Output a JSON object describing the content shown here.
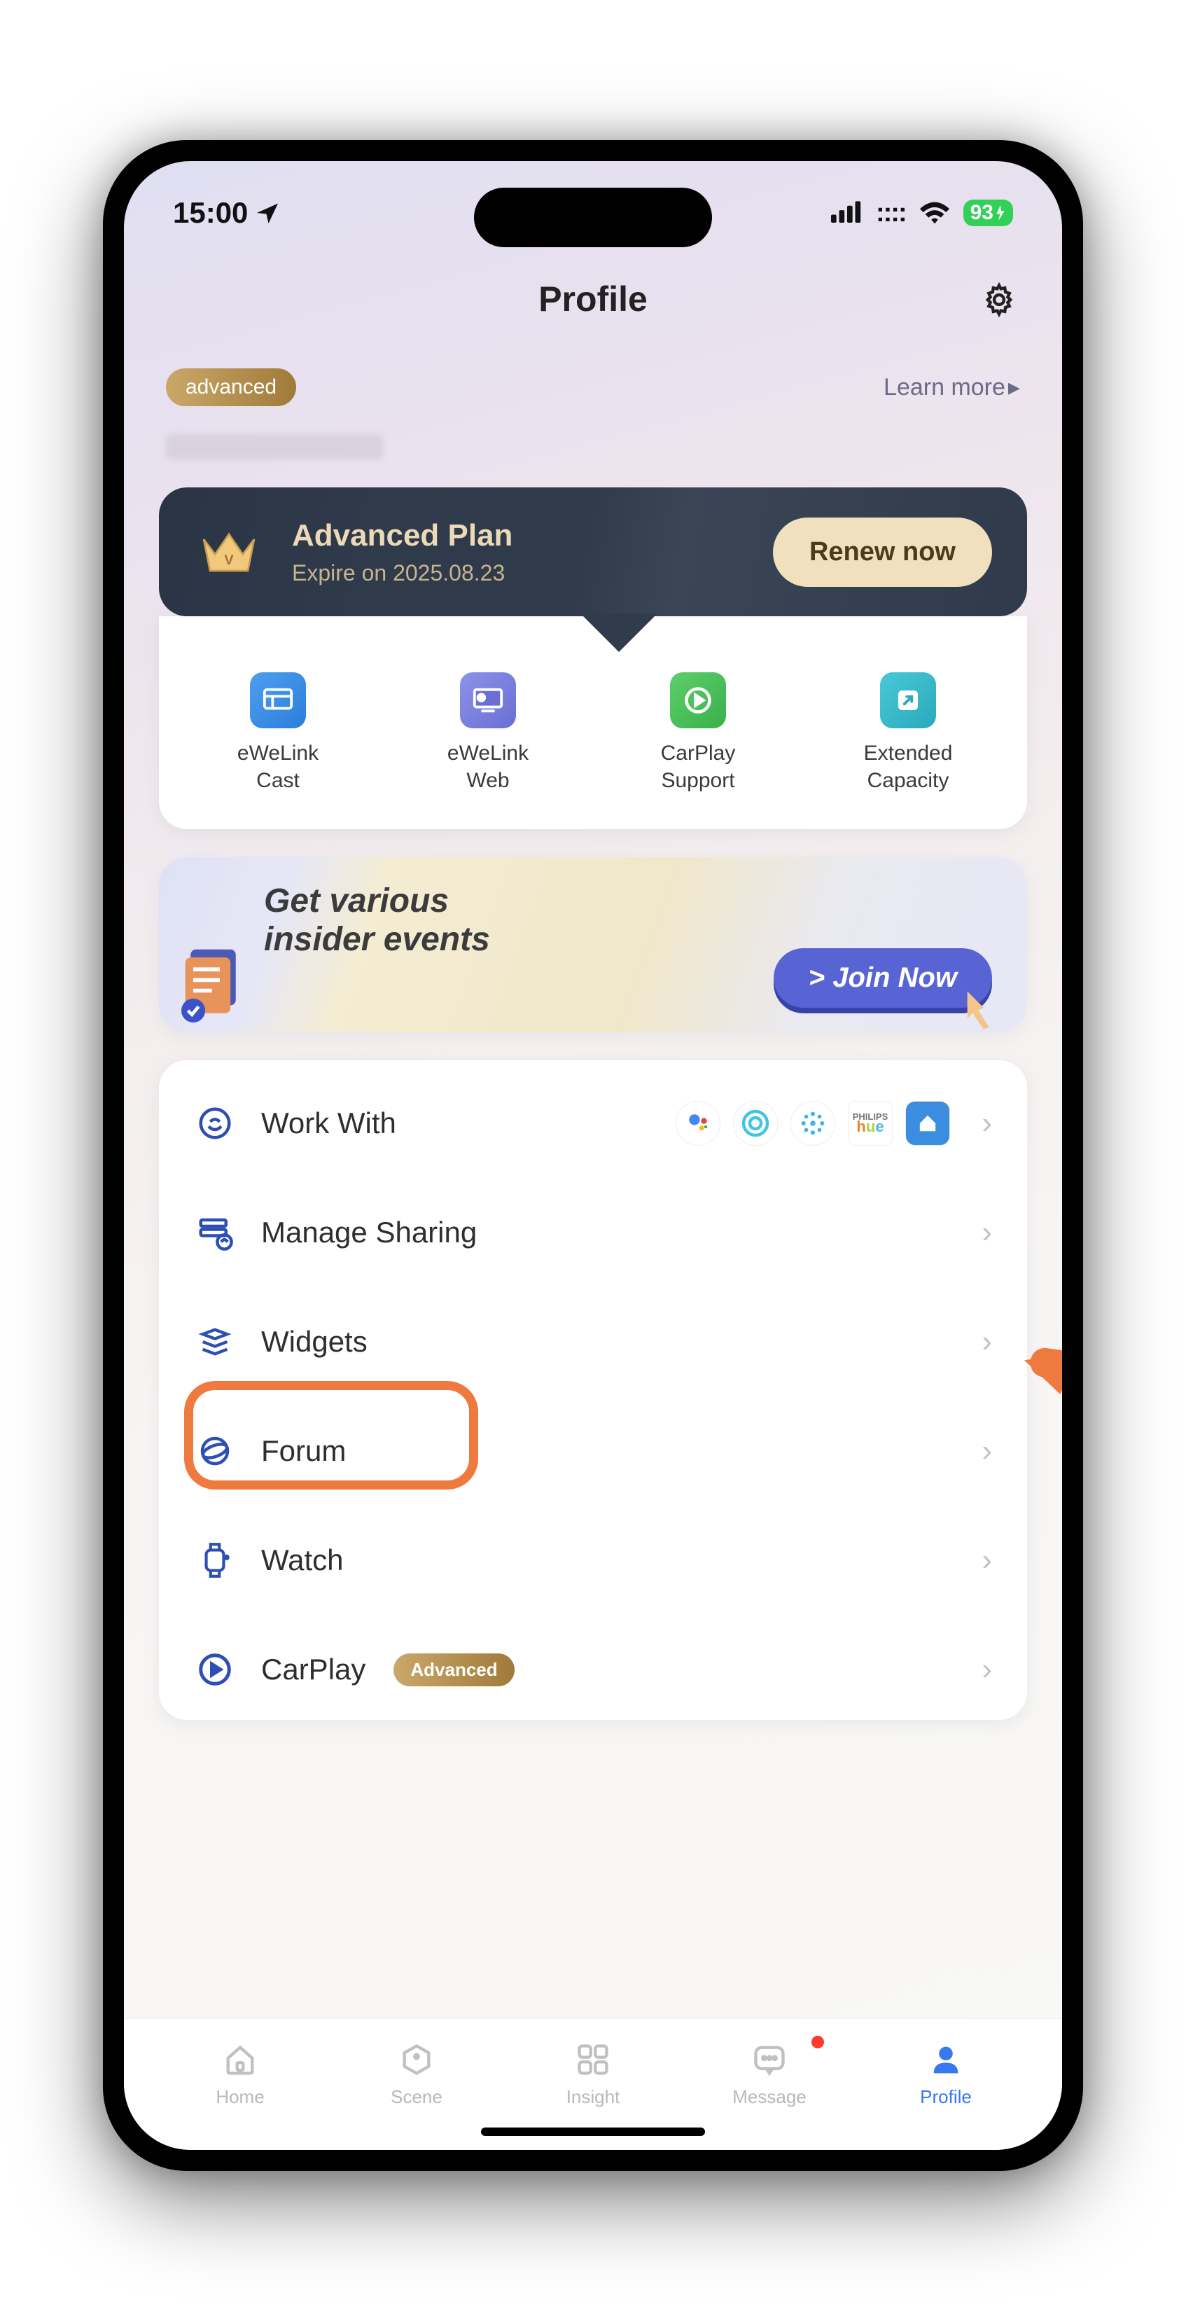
{
  "status": {
    "time": "15:00",
    "battery": "93"
  },
  "header": {
    "title": "Profile"
  },
  "account": {
    "badge": "advanced",
    "learn_more": "Learn more"
  },
  "plan": {
    "title": "Advanced Plan",
    "subtitle": "Expire on 2025.08.23",
    "renew": "Renew now"
  },
  "features": [
    {
      "label": "eWeLink\nCast"
    },
    {
      "label": "eWeLink\nWeb"
    },
    {
      "label": "CarPlay\nSupport"
    },
    {
      "label": "Extended\nCapacity"
    }
  ],
  "promo": {
    "title_l1": "Get various",
    "title_l2": "insider events",
    "cta": "> Join Now"
  },
  "menu": [
    {
      "label": "Work With",
      "partners": [
        "google",
        "alexa",
        "smartthings",
        "hue",
        "home"
      ]
    },
    {
      "label": "Manage Sharing"
    },
    {
      "label": "Widgets"
    },
    {
      "label": "Forum",
      "highlighted": true
    },
    {
      "label": "Watch"
    },
    {
      "label": "CarPlay",
      "badge": "Advanced"
    }
  ],
  "tabs": [
    {
      "label": "Home"
    },
    {
      "label": "Scene"
    },
    {
      "label": "Insight"
    },
    {
      "label": "Message",
      "dot": true
    },
    {
      "label": "Profile",
      "active": true
    }
  ]
}
